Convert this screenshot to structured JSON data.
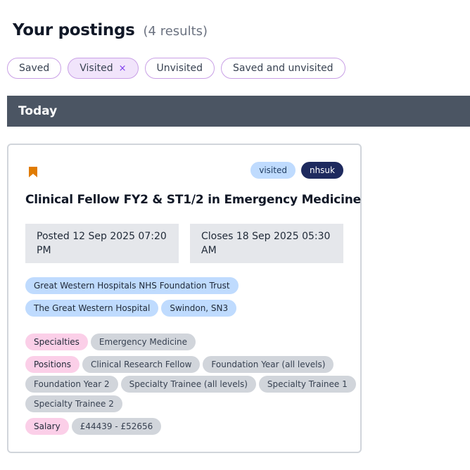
{
  "header": {
    "title": "Your postings",
    "result_count": "(4 results)"
  },
  "filters": [
    {
      "label": "Saved",
      "active": false
    },
    {
      "label": "Visited",
      "active": true,
      "remove_glyph": "×"
    },
    {
      "label": "Unvisited",
      "active": false
    },
    {
      "label": "Saved and unvisited",
      "active": false
    }
  ],
  "section": {
    "title": "Today"
  },
  "posting": {
    "bookmark_icon": "bookmark-icon",
    "bookmark_color": "#e07b00",
    "badges": {
      "status": "visited",
      "source": "nhsuk"
    },
    "title": "Clinical Fellow FY2 & ST1/2 in Emergency Medicine",
    "posted": "Posted 12 Sep 2025 07:20 PM",
    "closes": "Closes 18 Sep 2025 05:30 AM",
    "employer": "Great Western Hospitals NHS Foundation Trust",
    "hospital": "The Great Western Hospital",
    "location": "Swindon, SN3",
    "specialties_label": "Specialties",
    "specialties": [
      "Emergency Medicine"
    ],
    "positions_label": "Positions",
    "positions": [
      "Clinical Research Fellow",
      "Foundation Year (all levels)",
      "Foundation Year 2",
      "Specialty Trainee (all levels)",
      "Specialty Trainee 1",
      "Specialty Trainee 2"
    ],
    "salary_label": "Salary",
    "salary": "£44439 - £52656"
  },
  "colors": {
    "section_bar": "#4b5563",
    "chip_border": "#c9a0e6",
    "chip_active_bg": "#f1e4fb",
    "badge_visited": "#bfdbfe",
    "badge_source": "#1e2a5e",
    "tag_label": "#fbcfe8",
    "tag_value": "#d1d5db"
  }
}
